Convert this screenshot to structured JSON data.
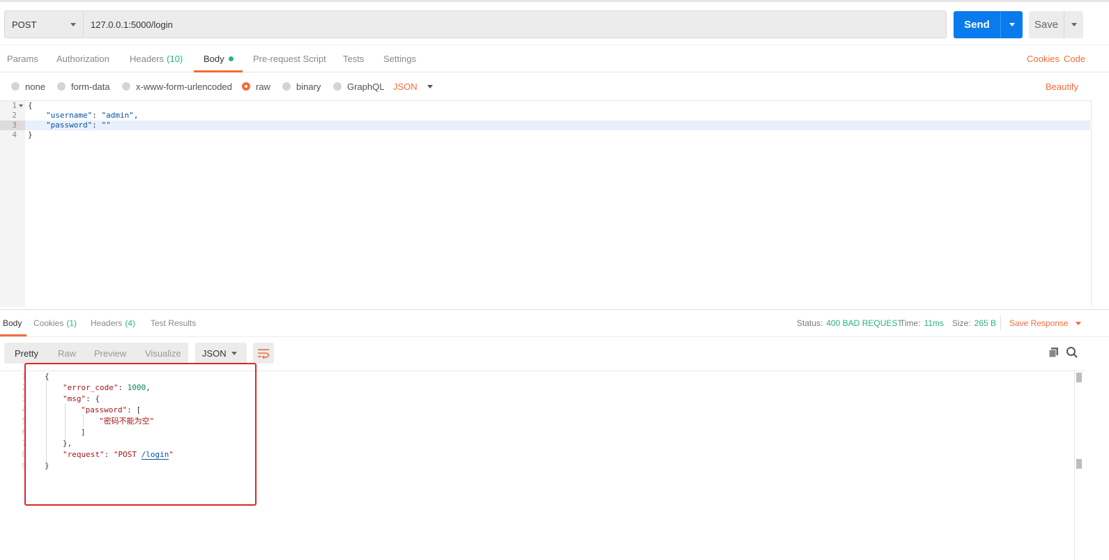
{
  "request": {
    "method": "POST",
    "url": "127.0.0.1:5000/login",
    "send_label": "Send",
    "save_label": "Save"
  },
  "request_tabs": {
    "params": "Params",
    "authorization": "Authorization",
    "headers": "Headers",
    "headers_count": "(10)",
    "body": "Body",
    "prerequest": "Pre-request Script",
    "tests": "Tests",
    "settings": "Settings",
    "cookies": "Cookies",
    "code": "Code"
  },
  "body_types": {
    "none": "none",
    "form_data": "form-data",
    "urlencoded": "x-www-form-urlencoded",
    "raw": "raw",
    "binary": "binary",
    "graphql": "GraphQL",
    "language": "JSON",
    "beautify": "Beautify",
    "selected": "raw"
  },
  "request_body": {
    "line_numbers": [
      "1",
      "2",
      "3",
      "4"
    ],
    "lines": {
      "l1": "{",
      "l2_key": "\"username\"",
      "l2_sep": ": ",
      "l2_val": "\"admin\"",
      "l2_end": ",",
      "l3_key": "\"password\"",
      "l3_sep": ": ",
      "l3_val": "\"\"",
      "l4": "}"
    }
  },
  "response_tabs": {
    "body": "Body",
    "cookies": "Cookies",
    "cookies_count": "(1)",
    "headers": "Headers",
    "headers_count": "(4)",
    "test_results": "Test Results"
  },
  "response_status": {
    "status_label": "Status:",
    "status_value": "400 BAD REQUEST",
    "time_label": "Time:",
    "time_value": "11ms",
    "size_label": "Size:",
    "size_value": "265 B",
    "save_response": "Save Response"
  },
  "response_view": {
    "pretty": "Pretty",
    "raw": "Raw",
    "preview": "Preview",
    "visualize": "Visualize",
    "format": "JSON"
  },
  "response_body": {
    "line_numbers": [
      "1",
      "2",
      "3",
      "4",
      "5",
      "6",
      "7",
      "8",
      "9"
    ],
    "l1": "{",
    "l2_key": "\"error_code\"",
    "l2_sep": ": ",
    "l2_val": "1000",
    "l2_end": ",",
    "l3_key": "\"msg\"",
    "l3_rest": ": {",
    "l4_key": "\"password\"",
    "l4_rest": ": [",
    "l5_val": "\"密码不能为空\"",
    "l6": "]",
    "l7": "},",
    "l8_key": "\"request\"",
    "l8_sep": ": ",
    "l8_val_a": "\"POST ",
    "l8_val_link": "/login",
    "l8_val_b": "\"",
    "l9": "}"
  },
  "colors": {
    "accent": "#f26b3a",
    "send": "#097bed",
    "success": "#26b47f",
    "annotation": "#e02424"
  }
}
